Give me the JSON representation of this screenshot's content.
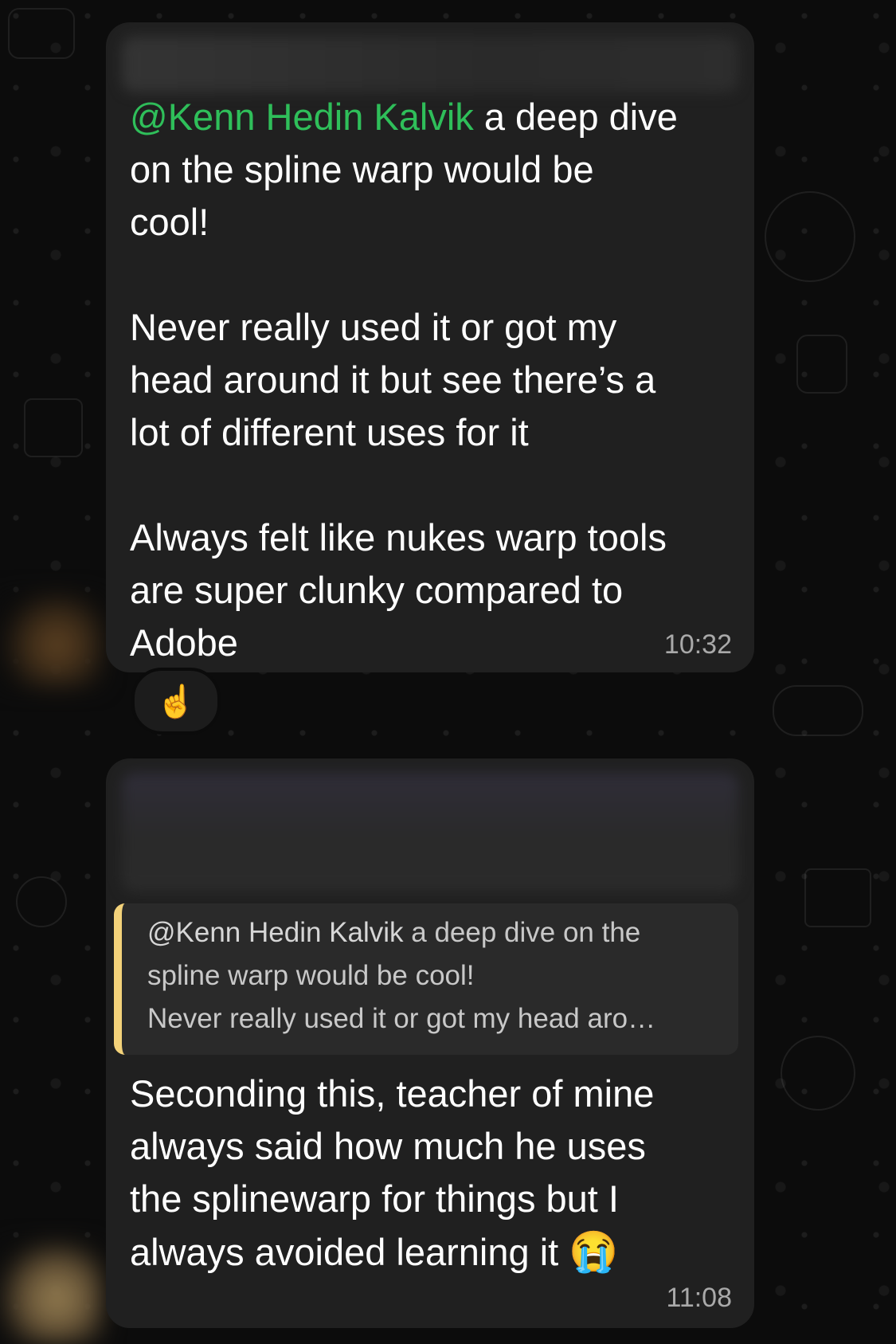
{
  "message1": {
    "mention": "@Kenn Hedin Kalvik",
    "text_after_mention": " a deep dive\non the spline warp would be\ncool!\n\nNever really used it or got my\nhead around it but see there’s a\nlot of different uses for it\n\nAlways felt like nukes warp tools\nare super clunky compared to\nAdobe",
    "time": "10:32",
    "reaction": "☝"
  },
  "message2": {
    "quote": {
      "author": "@Kenn Hedin Kalvik",
      "line1_rest": " a deep dive on the",
      "line2": "spline warp would be cool!",
      "line3": "Never really used it or got my head aro…"
    },
    "text": "Seconding this, teacher of mine\nalways said how much he uses\nthe splinewarp for things but I\nalways avoided learning it ",
    "emoji": "😭",
    "time": "11:08"
  },
  "colors": {
    "mention": "#2fbf5a",
    "bubble": "#202020",
    "quote_bar": "#f3d27a"
  }
}
